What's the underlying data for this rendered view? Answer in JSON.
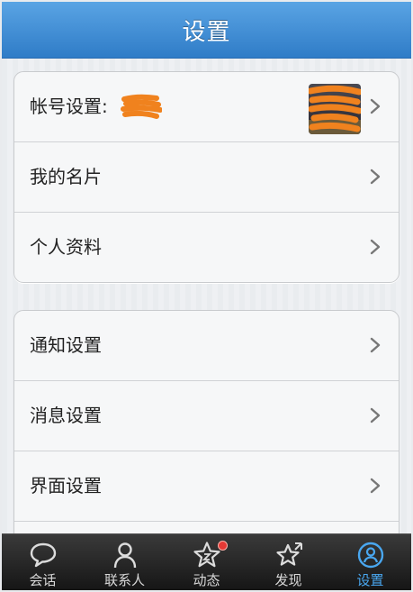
{
  "header": {
    "title": "设置"
  },
  "groups": [
    {
      "items": [
        {
          "label": "帐号设置:"
        },
        {
          "label": "我的名片"
        },
        {
          "label": "个人资料"
        }
      ]
    },
    {
      "items": [
        {
          "label": "通知设置"
        },
        {
          "label": "消息设置"
        },
        {
          "label": "界面设置"
        }
      ]
    }
  ],
  "tabbar": {
    "tabs": [
      {
        "label": "会话",
        "icon": "chat-bubble-icon"
      },
      {
        "label": "联系人",
        "icon": "contact-person-icon"
      },
      {
        "label": "动态",
        "icon": "star-icon",
        "badge": true
      },
      {
        "label": "发现",
        "icon": "discover-star-icon"
      },
      {
        "label": "设置",
        "icon": "settings-person-icon",
        "active": true
      }
    ]
  },
  "colors": {
    "header": "#2f7cc7",
    "active_tab": "#49a7f0",
    "redaction": "#f0821e",
    "badge": "#e53935"
  }
}
